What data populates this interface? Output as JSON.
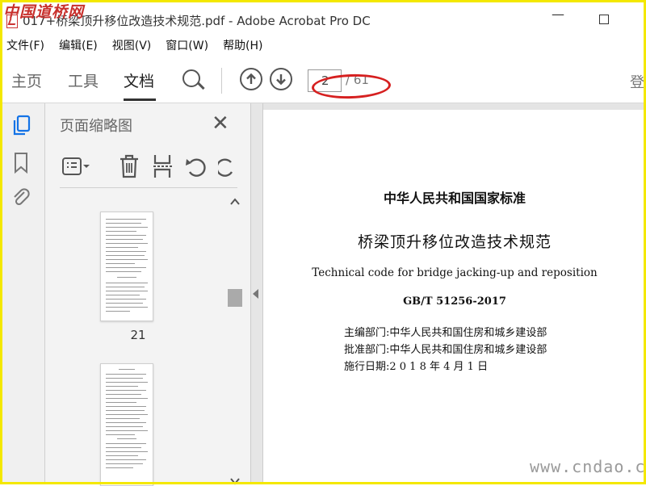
{
  "watermark": {
    "logo_text": "中国道桥网",
    "site_text": "www.cndao.com"
  },
  "window": {
    "title": "017+桥梁顶升移位改造技术规范.pdf - Adobe Acrobat Pro DC"
  },
  "menu": [
    "文件(F)",
    "编辑(E)",
    "视图(V)",
    "窗口(W)",
    "帮助(H)"
  ],
  "toolbar": {
    "tabs": [
      "主页",
      "工具",
      "文档"
    ],
    "active_tab": "文档",
    "page_current": "2",
    "page_total": "/ 61",
    "right_partial": "登"
  },
  "thumbnails": {
    "title": "页面缩略图",
    "pages": [
      {
        "label": "21"
      },
      {
        "label": ""
      }
    ]
  },
  "document": {
    "line1": "中华人民共和国国家标准",
    "line2": "桥梁顶升移位改造技术规范",
    "line3": "Technical code for bridge jacking-up and reposition",
    "line4": "GB/T 51256-2017",
    "line5": "主编部门:中华人民共和国住房和城乡建设部",
    "line6": "批准部门:中华人民共和国住房和城乡建设部",
    "line7": "施行日期:2 0 1 8 年 4 月 1 日"
  },
  "colors": {
    "annotation_red": "#d62020",
    "frame_yellow": "#f4e800",
    "brand_red": "#c8302c"
  }
}
